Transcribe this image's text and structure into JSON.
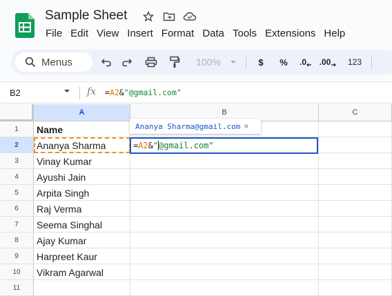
{
  "app": {
    "title": "Sample Sheet",
    "menu": [
      "File",
      "Edit",
      "View",
      "Insert",
      "Format",
      "Data",
      "Tools",
      "Extensions",
      "Help"
    ]
  },
  "toolbar": {
    "menus_label": "Menus",
    "zoom": "100%",
    "currency": "$",
    "percent": "%",
    "dec_decrease": ".0",
    "dec_increase": ".00",
    "number_format": "123"
  },
  "formula_bar": {
    "name_box": "B2",
    "fx": "fx",
    "formula_eq": "=",
    "formula_ref": "A2",
    "formula_amp": "&",
    "formula_str": "\"@gmail.com\""
  },
  "grid": {
    "columns": [
      "A",
      "B",
      "C"
    ],
    "rows": [
      "1",
      "2",
      "3",
      "4",
      "5",
      "6",
      "7",
      "8",
      "9",
      "10",
      "11"
    ],
    "col_a_values": [
      "Name",
      "Ananya Sharma",
      "Vinay Kumar",
      "Ayushi Jain",
      "Arpita Singh",
      "Raj Verma",
      "Seema Singhal",
      "Ajay Kumar",
      "Harpreet Kaur",
      "Vikram Agarwal",
      ""
    ],
    "selected_cell": "B2",
    "preview_text": "Ananya Sharma@gmail.com",
    "preview_close": "×",
    "editor_eq": "=",
    "editor_ref": "A2",
    "editor_amp": "&",
    "editor_str_open": "\"",
    "editor_str_rest": "@gmail.com\""
  },
  "colors": {
    "accent": "#0b57d0",
    "reference": "#e37400",
    "string": "#188038",
    "sheets_green": "#0f9d58"
  }
}
